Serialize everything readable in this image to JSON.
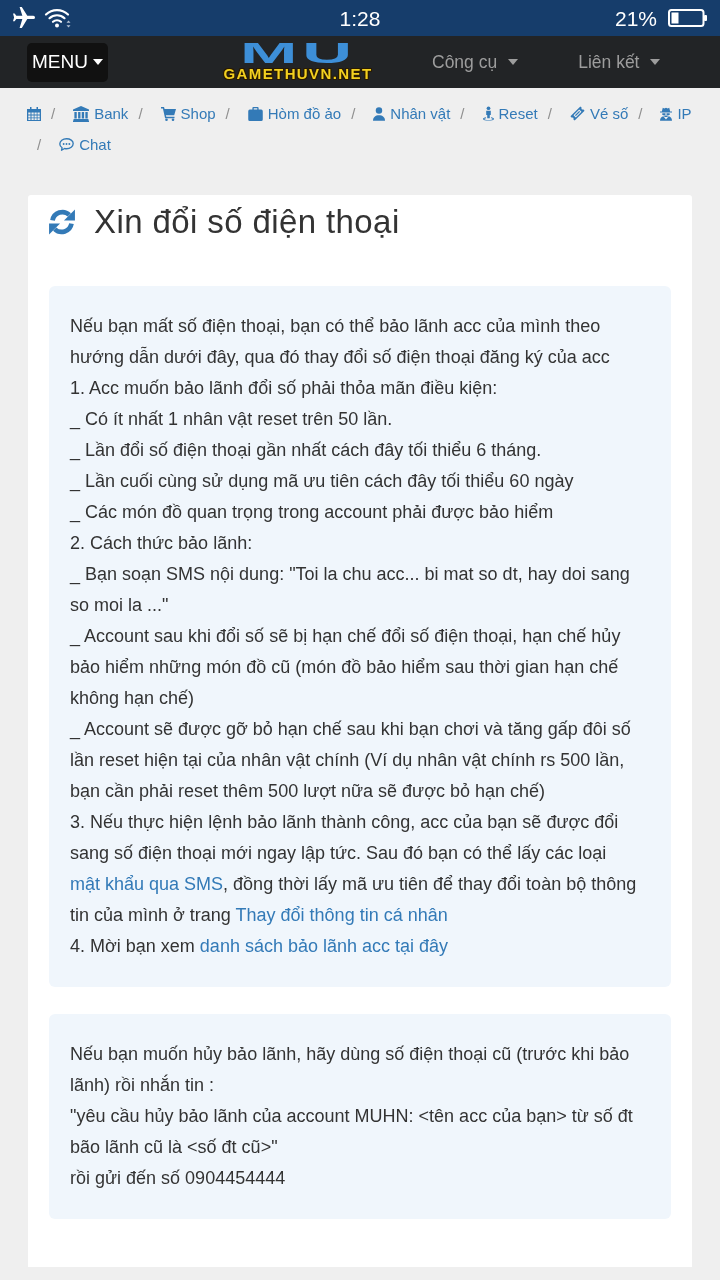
{
  "status_bar": {
    "time": "1:28",
    "battery": "21%"
  },
  "navbar": {
    "menu_button": {
      "label": "MENU"
    },
    "logo": {
      "backdrop": "MU",
      "text": "GAMETHUVN.NET"
    },
    "dropdowns": [
      {
        "label": "Công cụ"
      },
      {
        "label": "Liên kết"
      }
    ]
  },
  "breadcrumb": [
    {
      "kind": "icon-link"
    },
    {
      "kind": "text-link",
      "separator": "/",
      "label": "Bank"
    },
    {
      "kind": "text-link",
      "separator": "/",
      "label": "Shop"
    },
    {
      "kind": "text-link",
      "separator": "/",
      "label": "Hòm đồ ảo"
    },
    {
      "kind": "text-link",
      "separator": "/",
      "label": "Nhân vật"
    },
    {
      "kind": "text-link",
      "separator": "/",
      "label": "Reset"
    },
    {
      "kind": "text-link",
      "separator": "/",
      "label": "Vé số"
    },
    {
      "kind": "text-link",
      "separator": "/",
      "label": "IP"
    },
    {
      "kind": "text-link",
      "separator": "/",
      "label": "Chat"
    }
  ],
  "title": "Xin đổi số điện thoại",
  "notices": [
    {
      "lines": [
        {
          "kind": "plain",
          "text": "Nếu bạn mất số điện thoại, bạn có thể bảo lãnh acc của mình theo hướng dẫn dưới đây, qua đó thay đổi số điện thoại đăng ký của acc"
        },
        {
          "kind": "plain",
          "text": "1. Acc muốn bảo lãnh đổi số phải thỏa mãn điều kiện:"
        },
        {
          "kind": "plain",
          "text": "_ Có ít nhất 1 nhân vật reset trên 50 lần."
        },
        {
          "kind": "plain",
          "text": "_ Lần đổi số điện thoại gần nhất cách đây tối thiểu 6 tháng."
        },
        {
          "kind": "plain",
          "text": "_ Lần cuối cùng sử dụng mã ưu tiên cách đây tối thiểu 60 ngày"
        },
        {
          "kind": "plain",
          "text": "_ Các món đồ quan trọng trong account phải được bảo hiểm"
        },
        {
          "kind": "plain",
          "text": "2. Cách thức bảo lãnh:"
        },
        {
          "kind": "plain",
          "text": "_ Bạn soạn SMS nội dung: \"Toi la chu acc... bi mat so dt, hay doi sang so moi la ...\""
        },
        {
          "kind": "plain",
          "text": "_ Account sau khi đổi số sẽ bị hạn chế đổi số điện thoại, hạn chế hủy bảo hiểm những món đồ cũ (món đồ bảo hiểm sau thời gian hạn chế không hạn chế)"
        },
        {
          "kind": "plain",
          "text": "_ Account sẽ được gỡ bỏ hạn chế sau khi bạn chơi và tăng gấp đôi số lần reset hiện tại của nhân vật chính (Ví dụ nhân vật chính rs 500 lần, bạn cần phải reset thêm 500 lượt nữa sẽ được bỏ hạn chế)"
        },
        {
          "kind": "linked",
          "parts": [
            {
              "kind": "text",
              "text": "3. Nếu thực hiện lệnh bảo lãnh thành công, acc của bạn sẽ được đổi sang số điện thoại mới ngay lập tức. Sau đó bạn có thể lấy các loại "
            },
            {
              "kind": "link",
              "text": "mật khẩu qua SMS"
            },
            {
              "kind": "text",
              "text": ", đồng thời lấy mã ưu tiên để thay đổi toàn bộ thông tin của mình ở trang "
            },
            {
              "kind": "link",
              "text": "Thay đổi thông tin cá nhân"
            }
          ]
        },
        {
          "kind": "linked",
          "parts": [
            {
              "kind": "text",
              "text": "4. Mời bạn xem "
            },
            {
              "kind": "link",
              "text": "danh sách bảo lãnh acc tại đây"
            }
          ]
        }
      ]
    },
    {
      "lines": [
        {
          "kind": "plain",
          "text": "Nếu bạn muốn hủy bảo lãnh, hãy dùng số điện thoại cũ (trước khi bảo lãnh) rồi nhắn tin :"
        },
        {
          "kind": "plain",
          "text": "\"yêu cầu hủy bảo lãnh của account MUHN: <tên acc của bạn> từ số đt bão lãnh cũ là <số đt cũ>\""
        },
        {
          "kind": "plain",
          "text": "rồi gửi đến số 0904454444"
        }
      ]
    }
  ]
}
